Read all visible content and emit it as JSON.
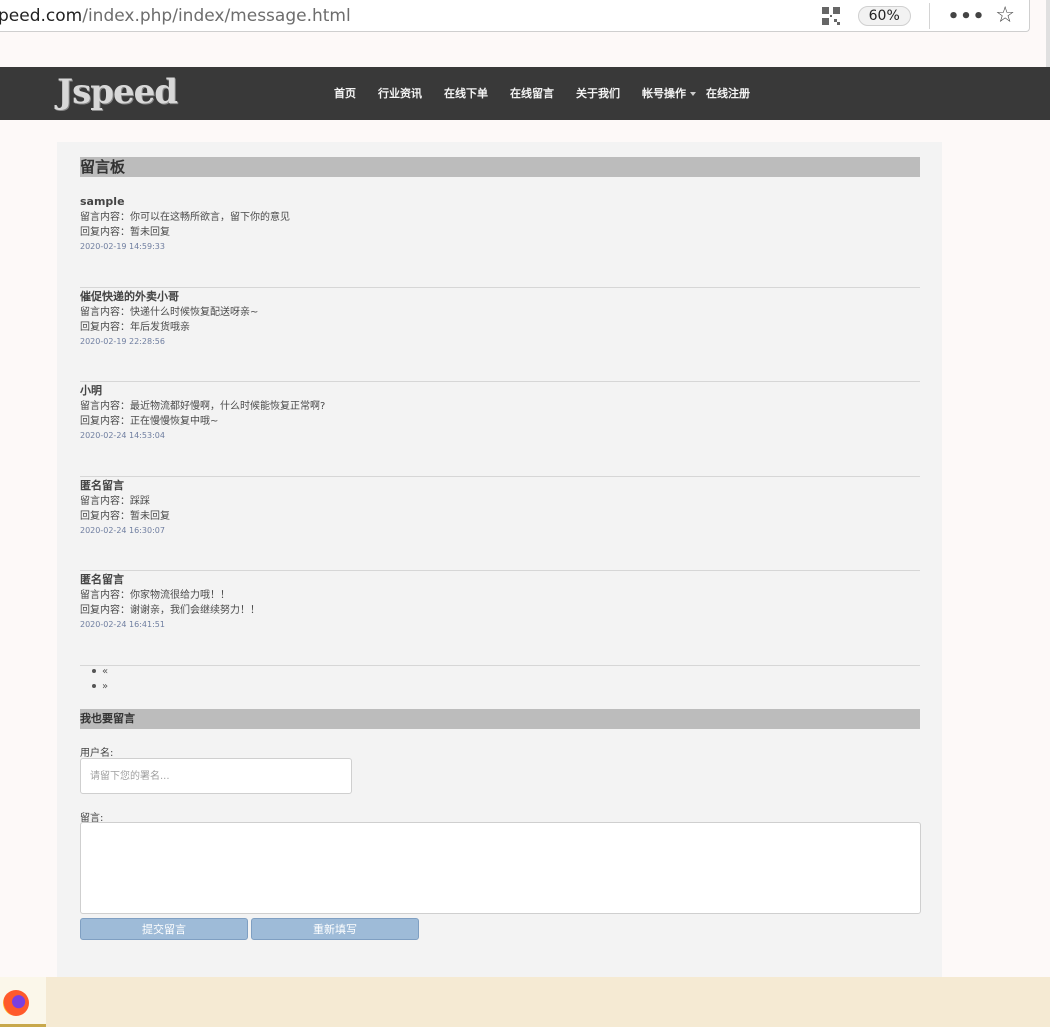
{
  "browser": {
    "url_host": "peed.com",
    "url_path": "/index.php/index/message.html",
    "zoom": "60%",
    "more_glyph": "•••",
    "star_glyph": "☆"
  },
  "site": {
    "logo": "Jspeed",
    "nav": [
      {
        "label": "首页"
      },
      {
        "label": "行业资讯"
      },
      {
        "label": "在线下单"
      },
      {
        "label": "在线留言"
      },
      {
        "label": "关于我们"
      },
      {
        "label": "帐号操作"
      },
      {
        "label": "在线注册"
      }
    ]
  },
  "board": {
    "title": "留言板",
    "messages": [
      {
        "author": "sample",
        "content": "留言内容：你可以在这畅所欲言，留下你的意见",
        "reply": "回复内容：暂未回复",
        "time": "2020-02-19 14:59:33"
      },
      {
        "author": "催促快递的外卖小哥",
        "content": "留言内容：快递什么时候恢复配送呀亲~",
        "reply": "回复内容：年后发货哦亲",
        "time": "2020-02-19 22:28:56"
      },
      {
        "author": "小明",
        "content": "留言内容：最近物流都好慢啊，什么时候能恢复正常啊?",
        "reply": "回复内容：正在慢慢恢复中哦~",
        "time": "2020-02-24 14:53:04"
      },
      {
        "author": "匿名留言",
        "content": "留言内容：踩踩",
        "reply": "回复内容：暂未回复",
        "time": "2020-02-24 16:30:07"
      },
      {
        "author": "匿名留言",
        "content": "留言内容：你家物流很给力哦！！",
        "reply": "回复内容：谢谢亲，我们会继续努力！！",
        "time": "2020-02-24 16:41:51"
      }
    ],
    "pager": {
      "prev": "«",
      "next": "»"
    }
  },
  "form": {
    "title": "我也要留言",
    "username_label": "用户名:",
    "username_placeholder": "请留下您的署名...",
    "message_label": "留言:",
    "submit_label": "提交留言",
    "reset_label": "重新填写"
  },
  "colors": {
    "header_bg": "#393939",
    "panel_bg": "#f3f3f3",
    "section_bar": "#bcbcbc",
    "button_bg": "#9ebbd8",
    "timestamp": "#6f7ea0"
  }
}
